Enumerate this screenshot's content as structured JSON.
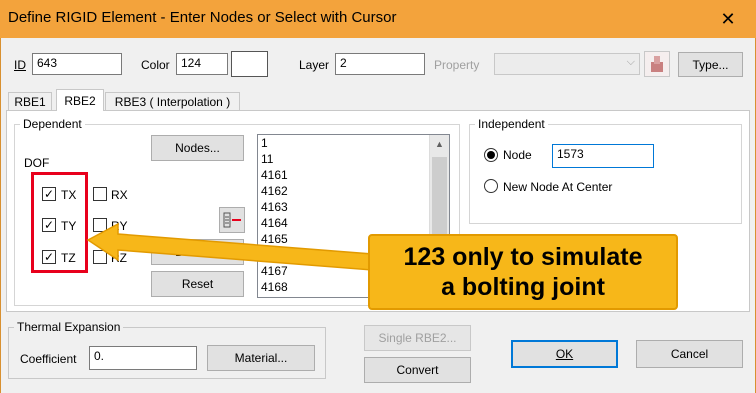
{
  "window": {
    "title": "Define RIGID Element - Enter Nodes or Select with Cursor",
    "close_glyph": "✕"
  },
  "header": {
    "id_label": "ID",
    "id_value": "643",
    "color_label": "Color",
    "color_value": "124",
    "layer_label": "Layer",
    "layer_value": "2",
    "property_label": "Property",
    "property_value": "",
    "type_button": "Type..."
  },
  "tabs": [
    "RBE1",
    "RBE2",
    "RBE3 ( Interpolation )"
  ],
  "dependent": {
    "group_label": "Dependent",
    "dof_label": "DOF",
    "dofs": [
      {
        "label": "TX",
        "checked": true
      },
      {
        "label": "TY",
        "checked": true
      },
      {
        "label": "TZ",
        "checked": true
      },
      {
        "label": "RX",
        "checked": false
      },
      {
        "label": "RY",
        "checked": false
      },
      {
        "label": "RZ",
        "checked": false
      }
    ],
    "nodes_button": "Nodes...",
    "delete_button": "Delete...",
    "reset_button": "Reset",
    "node_list": [
      "1",
      "11",
      "4161",
      "4162",
      "4163",
      "4164",
      "4165",
      "4166",
      "4167",
      "4168"
    ]
  },
  "independent": {
    "group_label": "Independent",
    "node_option": "Node",
    "node_value": "1573",
    "new_node_option": "New Node At Center"
  },
  "thermal": {
    "group_label": "Thermal Expansion",
    "coefficient_label": "Coefficient",
    "coefficient_value": "0.",
    "material_button": "Material..."
  },
  "buttons": {
    "single_rbe2": "Single RBE2...",
    "convert": "Convert",
    "ok": "OK",
    "cancel": "Cancel"
  },
  "annotation": {
    "line1": "123 only to simulate",
    "line2": "a bolting joint",
    "highlight_color": "#e8001c",
    "callout_color": "#f7b719"
  },
  "colors": {
    "titlebar": "#f3a33c",
    "selected_color_swatch": "#ffffff"
  }
}
